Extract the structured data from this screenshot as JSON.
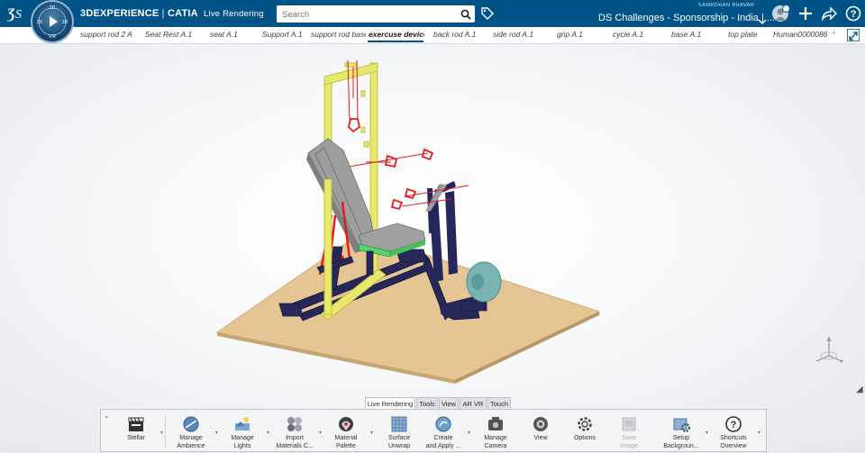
{
  "header": {
    "brand_bold": "3DEXPERIENCE",
    "brand_sep": "|",
    "brand_product": "CATIA",
    "brand_app": "Live Rendering",
    "search": {
      "placeholder": "Search",
      "value": ""
    },
    "user_name": "SAMRDHAN BHAVAR",
    "space_title": "DS Challenges - Sponsorship - India | ..."
  },
  "compass": {
    "top_label": "3D",
    "left_label": "3D",
    "right_label": "3D",
    "bottom_label": "V.R"
  },
  "tabs": [
    {
      "label": "support rod 2 A",
      "active": false
    },
    {
      "label": "Seat Rest A.1",
      "active": false
    },
    {
      "label": "seat A.1",
      "active": false
    },
    {
      "label": "Support A.1",
      "active": false
    },
    {
      "label": "support rod base",
      "active": false
    },
    {
      "label": "exercuse device",
      "active": true
    },
    {
      "label": "back rod A.1",
      "active": false
    },
    {
      "label": "side rod A.1",
      "active": false
    },
    {
      "label": "grip A.1",
      "active": false
    },
    {
      "label": "cycle A.1",
      "active": false
    },
    {
      "label": "base A.1",
      "active": false
    },
    {
      "label": "top plate",
      "active": false
    },
    {
      "label": "Human0000086",
      "active": false
    }
  ],
  "tab_add_label": "+",
  "action_bar": {
    "tabs": [
      {
        "label": "Live Rendering",
        "active": true
      },
      {
        "label": "Tools",
        "active": false
      },
      {
        "label": "View",
        "active": false
      },
      {
        "label": "AR VR",
        "active": false
      },
      {
        "label": "Touch",
        "active": false
      }
    ],
    "tools": [
      {
        "label": "Stellar",
        "icon": "clapperboard-icon",
        "disabled": false
      },
      {
        "label": "Manage\nAmbience",
        "icon": "ambience-sphere-icon",
        "disabled": false
      },
      {
        "label": "Manage\nLights",
        "icon": "lights-icon",
        "disabled": false
      },
      {
        "label": "Import\nMaterials C...",
        "icon": "materials-spheres-icon",
        "disabled": false
      },
      {
        "label": "Material\nPalette",
        "icon": "palette-icon",
        "disabled": false
      },
      {
        "label": "Surface\nUnwrap",
        "icon": "grid-icon",
        "disabled": false
      },
      {
        "label": "Create\nand Apply ...",
        "icon": "apply-material-icon",
        "disabled": false
      },
      {
        "label": "Manage\nCamera",
        "icon": "camera-icon",
        "disabled": false
      },
      {
        "label": "View",
        "icon": "view-lens-icon",
        "disabled": false
      },
      {
        "label": "Options",
        "icon": "gear-icon",
        "disabled": false
      },
      {
        "label": "Save\nImage",
        "icon": "save-image-icon",
        "disabled": true
      },
      {
        "label": "Setup\nBackgroun...",
        "icon": "setup-background-icon",
        "disabled": false
      },
      {
        "label": "Shortcuts\nOverview",
        "icon": "help-icon",
        "disabled": false
      }
    ]
  },
  "colors": {
    "header_bg": "#005386",
    "floor": "#e8c89a",
    "frame_yellow": "#e8e870",
    "bench_gray": "#9b9b9b",
    "base_navy": "#27285a",
    "rope_red": "#e31b1b",
    "wheel_teal": "#76b2b0",
    "seat_green": "#56d46d"
  }
}
